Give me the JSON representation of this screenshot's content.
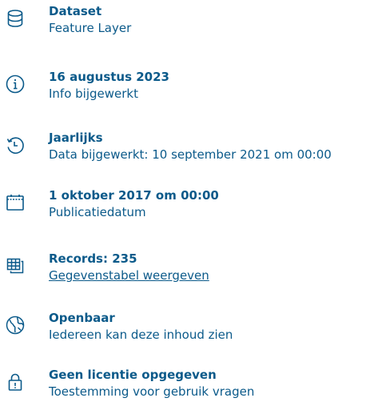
{
  "items": [
    {
      "icon": "database-icon",
      "title": "Dataset",
      "subtitle": "Feature Layer"
    },
    {
      "icon": "info-icon",
      "title": "16 augustus 2023",
      "subtitle": "Info bijgewerkt"
    },
    {
      "icon": "history-icon",
      "title": "Jaarlijks",
      "subtitle": "Data bijgewerkt: 10 september 2021 om 00:00"
    },
    {
      "icon": "calendar-icon",
      "title": "1 oktober 2017 om 00:00",
      "subtitle": "Publicatiedatum"
    },
    {
      "icon": "table-icon",
      "title": "Records: 235",
      "subtitle": "Gegevenstabel weergeven"
    },
    {
      "icon": "globe-icon",
      "title": "Openbaar",
      "subtitle": "Iedereen kan deze inhoud zien"
    },
    {
      "icon": "lock-icon",
      "title": "Geen licentie opgegeven",
      "subtitle": "Toestemming voor gebruik vragen"
    }
  ],
  "colors": {
    "text": "#0b5a8a",
    "background": "#ffffff"
  }
}
